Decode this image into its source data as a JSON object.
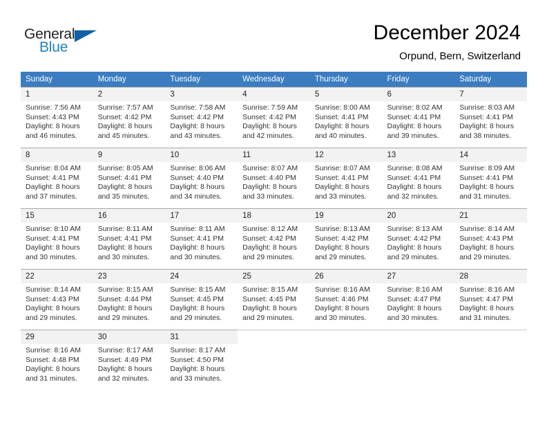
{
  "logo": {
    "word1": "General",
    "word2": "Blue",
    "triangle_color": "#1160a8",
    "blue_color": "#1f7fc4"
  },
  "header": {
    "title": "December 2024",
    "subtitle": "Orpund, Bern, Switzerland"
  },
  "calendar": {
    "header_bg": "#3b7dc0",
    "daynum_bg": "#f2f2f2",
    "weekday_headers": [
      "Sunday",
      "Monday",
      "Tuesday",
      "Wednesday",
      "Thursday",
      "Friday",
      "Saturday"
    ],
    "weeks": [
      [
        {
          "day": "1",
          "sunrise": "Sunrise: 7:56 AM",
          "sunset": "Sunset: 4:43 PM",
          "daylight1": "Daylight: 8 hours",
          "daylight2": "and 46 minutes."
        },
        {
          "day": "2",
          "sunrise": "Sunrise: 7:57 AM",
          "sunset": "Sunset: 4:42 PM",
          "daylight1": "Daylight: 8 hours",
          "daylight2": "and 45 minutes."
        },
        {
          "day": "3",
          "sunrise": "Sunrise: 7:58 AM",
          "sunset": "Sunset: 4:42 PM",
          "daylight1": "Daylight: 8 hours",
          "daylight2": "and 43 minutes."
        },
        {
          "day": "4",
          "sunrise": "Sunrise: 7:59 AM",
          "sunset": "Sunset: 4:42 PM",
          "daylight1": "Daylight: 8 hours",
          "daylight2": "and 42 minutes."
        },
        {
          "day": "5",
          "sunrise": "Sunrise: 8:00 AM",
          "sunset": "Sunset: 4:41 PM",
          "daylight1": "Daylight: 8 hours",
          "daylight2": "and 40 minutes."
        },
        {
          "day": "6",
          "sunrise": "Sunrise: 8:02 AM",
          "sunset": "Sunset: 4:41 PM",
          "daylight1": "Daylight: 8 hours",
          "daylight2": "and 39 minutes."
        },
        {
          "day": "7",
          "sunrise": "Sunrise: 8:03 AM",
          "sunset": "Sunset: 4:41 PM",
          "daylight1": "Daylight: 8 hours",
          "daylight2": "and 38 minutes."
        }
      ],
      [
        {
          "day": "8",
          "sunrise": "Sunrise: 8:04 AM",
          "sunset": "Sunset: 4:41 PM",
          "daylight1": "Daylight: 8 hours",
          "daylight2": "and 37 minutes."
        },
        {
          "day": "9",
          "sunrise": "Sunrise: 8:05 AM",
          "sunset": "Sunset: 4:41 PM",
          "daylight1": "Daylight: 8 hours",
          "daylight2": "and 35 minutes."
        },
        {
          "day": "10",
          "sunrise": "Sunrise: 8:06 AM",
          "sunset": "Sunset: 4:40 PM",
          "daylight1": "Daylight: 8 hours",
          "daylight2": "and 34 minutes."
        },
        {
          "day": "11",
          "sunrise": "Sunrise: 8:07 AM",
          "sunset": "Sunset: 4:40 PM",
          "daylight1": "Daylight: 8 hours",
          "daylight2": "and 33 minutes."
        },
        {
          "day": "12",
          "sunrise": "Sunrise: 8:07 AM",
          "sunset": "Sunset: 4:41 PM",
          "daylight1": "Daylight: 8 hours",
          "daylight2": "and 33 minutes."
        },
        {
          "day": "13",
          "sunrise": "Sunrise: 8:08 AM",
          "sunset": "Sunset: 4:41 PM",
          "daylight1": "Daylight: 8 hours",
          "daylight2": "and 32 minutes."
        },
        {
          "day": "14",
          "sunrise": "Sunrise: 8:09 AM",
          "sunset": "Sunset: 4:41 PM",
          "daylight1": "Daylight: 8 hours",
          "daylight2": "and 31 minutes."
        }
      ],
      [
        {
          "day": "15",
          "sunrise": "Sunrise: 8:10 AM",
          "sunset": "Sunset: 4:41 PM",
          "daylight1": "Daylight: 8 hours",
          "daylight2": "and 30 minutes."
        },
        {
          "day": "16",
          "sunrise": "Sunrise: 8:11 AM",
          "sunset": "Sunset: 4:41 PM",
          "daylight1": "Daylight: 8 hours",
          "daylight2": "and 30 minutes."
        },
        {
          "day": "17",
          "sunrise": "Sunrise: 8:11 AM",
          "sunset": "Sunset: 4:41 PM",
          "daylight1": "Daylight: 8 hours",
          "daylight2": "and 30 minutes."
        },
        {
          "day": "18",
          "sunrise": "Sunrise: 8:12 AM",
          "sunset": "Sunset: 4:42 PM",
          "daylight1": "Daylight: 8 hours",
          "daylight2": "and 29 minutes."
        },
        {
          "day": "19",
          "sunrise": "Sunrise: 8:13 AM",
          "sunset": "Sunset: 4:42 PM",
          "daylight1": "Daylight: 8 hours",
          "daylight2": "and 29 minutes."
        },
        {
          "day": "20",
          "sunrise": "Sunrise: 8:13 AM",
          "sunset": "Sunset: 4:42 PM",
          "daylight1": "Daylight: 8 hours",
          "daylight2": "and 29 minutes."
        },
        {
          "day": "21",
          "sunrise": "Sunrise: 8:14 AM",
          "sunset": "Sunset: 4:43 PM",
          "daylight1": "Daylight: 8 hours",
          "daylight2": "and 29 minutes."
        }
      ],
      [
        {
          "day": "22",
          "sunrise": "Sunrise: 8:14 AM",
          "sunset": "Sunset: 4:43 PM",
          "daylight1": "Daylight: 8 hours",
          "daylight2": "and 29 minutes."
        },
        {
          "day": "23",
          "sunrise": "Sunrise: 8:15 AM",
          "sunset": "Sunset: 4:44 PM",
          "daylight1": "Daylight: 8 hours",
          "daylight2": "and 29 minutes."
        },
        {
          "day": "24",
          "sunrise": "Sunrise: 8:15 AM",
          "sunset": "Sunset: 4:45 PM",
          "daylight1": "Daylight: 8 hours",
          "daylight2": "and 29 minutes."
        },
        {
          "day": "25",
          "sunrise": "Sunrise: 8:15 AM",
          "sunset": "Sunset: 4:45 PM",
          "daylight1": "Daylight: 8 hours",
          "daylight2": "and 29 minutes."
        },
        {
          "day": "26",
          "sunrise": "Sunrise: 8:16 AM",
          "sunset": "Sunset: 4:46 PM",
          "daylight1": "Daylight: 8 hours",
          "daylight2": "and 30 minutes."
        },
        {
          "day": "27",
          "sunrise": "Sunrise: 8:16 AM",
          "sunset": "Sunset: 4:47 PM",
          "daylight1": "Daylight: 8 hours",
          "daylight2": "and 30 minutes."
        },
        {
          "day": "28",
          "sunrise": "Sunrise: 8:16 AM",
          "sunset": "Sunset: 4:47 PM",
          "daylight1": "Daylight: 8 hours",
          "daylight2": "and 31 minutes."
        }
      ],
      [
        {
          "day": "29",
          "sunrise": "Sunrise: 8:16 AM",
          "sunset": "Sunset: 4:48 PM",
          "daylight1": "Daylight: 8 hours",
          "daylight2": "and 31 minutes."
        },
        {
          "day": "30",
          "sunrise": "Sunrise: 8:17 AM",
          "sunset": "Sunset: 4:49 PM",
          "daylight1": "Daylight: 8 hours",
          "daylight2": "and 32 minutes."
        },
        {
          "day": "31",
          "sunrise": "Sunrise: 8:17 AM",
          "sunset": "Sunset: 4:50 PM",
          "daylight1": "Daylight: 8 hours",
          "daylight2": "and 33 minutes."
        },
        {
          "day": "",
          "sunrise": "",
          "sunset": "",
          "daylight1": "",
          "daylight2": ""
        },
        {
          "day": "",
          "sunrise": "",
          "sunset": "",
          "daylight1": "",
          "daylight2": ""
        },
        {
          "day": "",
          "sunrise": "",
          "sunset": "",
          "daylight1": "",
          "daylight2": ""
        },
        {
          "day": "",
          "sunrise": "",
          "sunset": "",
          "daylight1": "",
          "daylight2": ""
        }
      ]
    ]
  }
}
